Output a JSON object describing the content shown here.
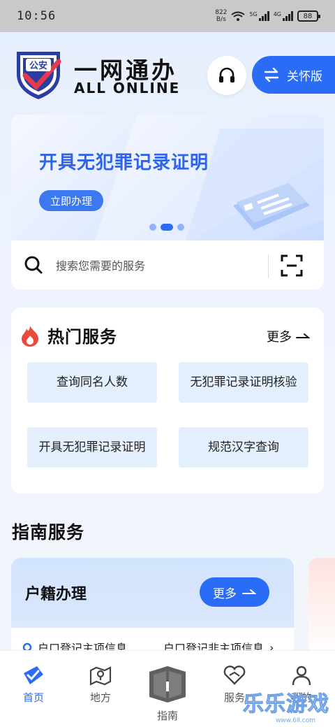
{
  "status_bar": {
    "time": "10:56",
    "net_speed_value": "822",
    "net_speed_unit": "B/s",
    "signal_1": "5G",
    "signal_2": "4G",
    "battery": "88"
  },
  "header": {
    "logo_text": "公安",
    "title": "一网通办",
    "subtitle": "ALL ONLINE",
    "care_label": "关怀版",
    "icons": {
      "service": "headset-icon",
      "care": "swap-arrows-icon"
    }
  },
  "banner": {
    "title": "开具无犯罪记录证明",
    "button_label": "立即办理",
    "active_slide": 2,
    "slide_count": 3
  },
  "search": {
    "placeholder": "搜索您需要的服务",
    "icons": {
      "search": "search-icon",
      "scan": "scan-icon"
    }
  },
  "hot_services": {
    "title": "热门服务",
    "more_label": "更多",
    "icon": "flame-icon",
    "items": [
      "查询同名人数",
      "无犯罪记录证明核验",
      "开具无犯罪记录证明",
      "规范汉字查询"
    ]
  },
  "guide": {
    "title": "指南服务",
    "card_title": "户籍办理",
    "more_label": "更多",
    "items": [
      "户口登记主项信息",
      "户口登记非主项信息"
    ]
  },
  "bottom_nav": {
    "items": [
      {
        "label": "首页",
        "icon": "home-icon",
        "active": true
      },
      {
        "label": "地方",
        "icon": "map-pin-icon",
        "active": false
      },
      {
        "label": "指南",
        "icon": "book-icon",
        "active": false
      },
      {
        "label": "服务",
        "icon": "heart-hands-icon",
        "active": false
      },
      {
        "label": "我的",
        "icon": "user-icon",
        "active": false
      }
    ]
  },
  "watermark": {
    "text": "乐乐游戏",
    "url": "www.6ll.com"
  },
  "colors": {
    "primary": "#2a6cf6",
    "accent_red": "#e84a3c",
    "card_blue": "#e4effd"
  }
}
